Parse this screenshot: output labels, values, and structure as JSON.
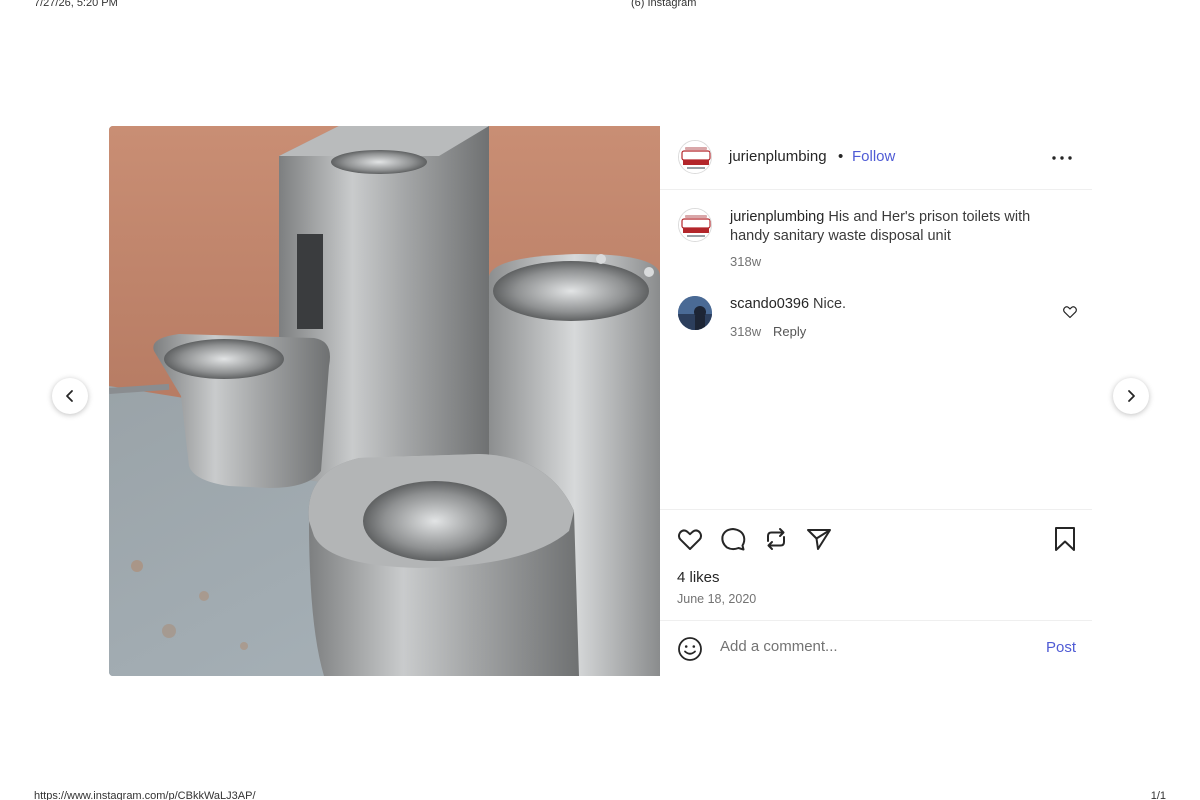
{
  "print": {
    "date": "7/27/26, 5:20 PM",
    "title": "(6) Instagram",
    "url": "https://www.instagram.com/p/CBkkWaLJ3AP/",
    "page": "1/1"
  },
  "post": {
    "image_alt": "stainless steel toilets and sinks",
    "author": "jurienplumbing",
    "separator": "•",
    "follow_label": "Follow",
    "more_icon": "more-horizontal-icon",
    "caption": {
      "user": "jurienplumbing",
      "text": "His and Her's prison toilets with handy sanitary waste disposal unit",
      "time": "318w"
    },
    "comments": [
      {
        "user": "scando0396",
        "text": "Nice.",
        "time": "318w",
        "reply_label": "Reply"
      }
    ],
    "likes": "4 likes",
    "date": "June 18, 2020",
    "add_comment_placeholder": "Add a comment...",
    "post_label": "Post"
  },
  "icons": {
    "like": "heart-icon",
    "comment": "comment-bubble-icon",
    "repost": "repost-icon",
    "share": "share-paper-plane-icon",
    "save": "bookmark-icon",
    "emoji": "emoji-icon",
    "prev": "chevron-left-icon",
    "next": "chevron-right-icon"
  },
  "colors": {
    "link_blue": "#4f5bd5",
    "secondary_text": "#737373",
    "divider": "#efefef"
  }
}
